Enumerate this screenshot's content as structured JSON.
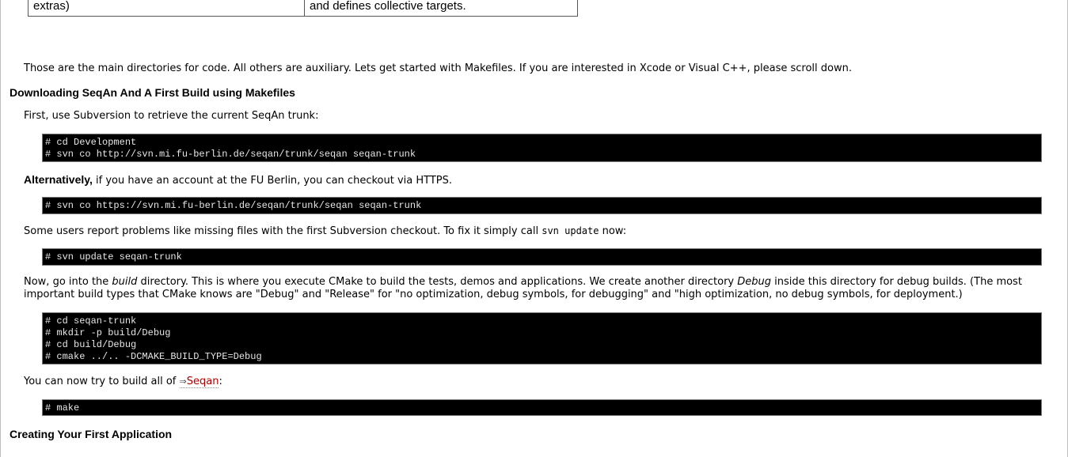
{
  "top_table": {
    "cell1": "extras)",
    "cell2": "and defines collective targets."
  },
  "intro": "Those are the main directories for code. All others are auxiliary. Lets get started with Makefiles. If you are interested in Xcode or Visual C++, please scroll down.",
  "section1": {
    "heading": "Downloading SeqAn And A First Build using Makefiles",
    "p1": "First, use Subversion to retrieve the current SeqAn trunk:",
    "code1": [
      "# cd Development",
      "# svn co http://svn.mi.fu-berlin.de/seqan/trunk/seqan seqan-trunk"
    ],
    "p2_strong": "Alternatively,",
    "p2_rest": " if you have an account at the FU Berlin, you can checkout via HTTPS.",
    "code2": [
      "# svn co https://svn.mi.fu-berlin.de/seqan/trunk/seqan seqan-trunk"
    ],
    "p3_pre": "Some users report problems like missing files with the first Subversion checkout. To fix it simply call ",
    "p3_code": "svn update",
    "p3_post": " now:",
    "code3": [
      "# svn update seqan-trunk"
    ],
    "p4_a": "Now, go into the ",
    "p4_em1": "build",
    "p4_b": " directory. This is where you execute CMake to build the tests, demos and applications. We create another directory ",
    "p4_em2": "Debug",
    "p4_c": " inside this directory for debug builds. (The most important build types that CMake knows are \"Debug\" and \"Release\" for \"no optimization, debug symbols, for debugging\" and \"high optimization, no debug symbols, for deployment.)",
    "code4": [
      "# cd seqan-trunk",
      "# mkdir -p build/Debug",
      "# cd build/Debug",
      "# cmake ../.. -DCMAKE_BUILD_TYPE=Debug"
    ],
    "p5_pre": "You can now try to build all of ",
    "p5_link_arrow": "⇒",
    "p5_link": "Seqan",
    "p5_post": ":",
    "code5": [
      "# make"
    ]
  },
  "section2": {
    "heading": "Creating Your First Application"
  }
}
